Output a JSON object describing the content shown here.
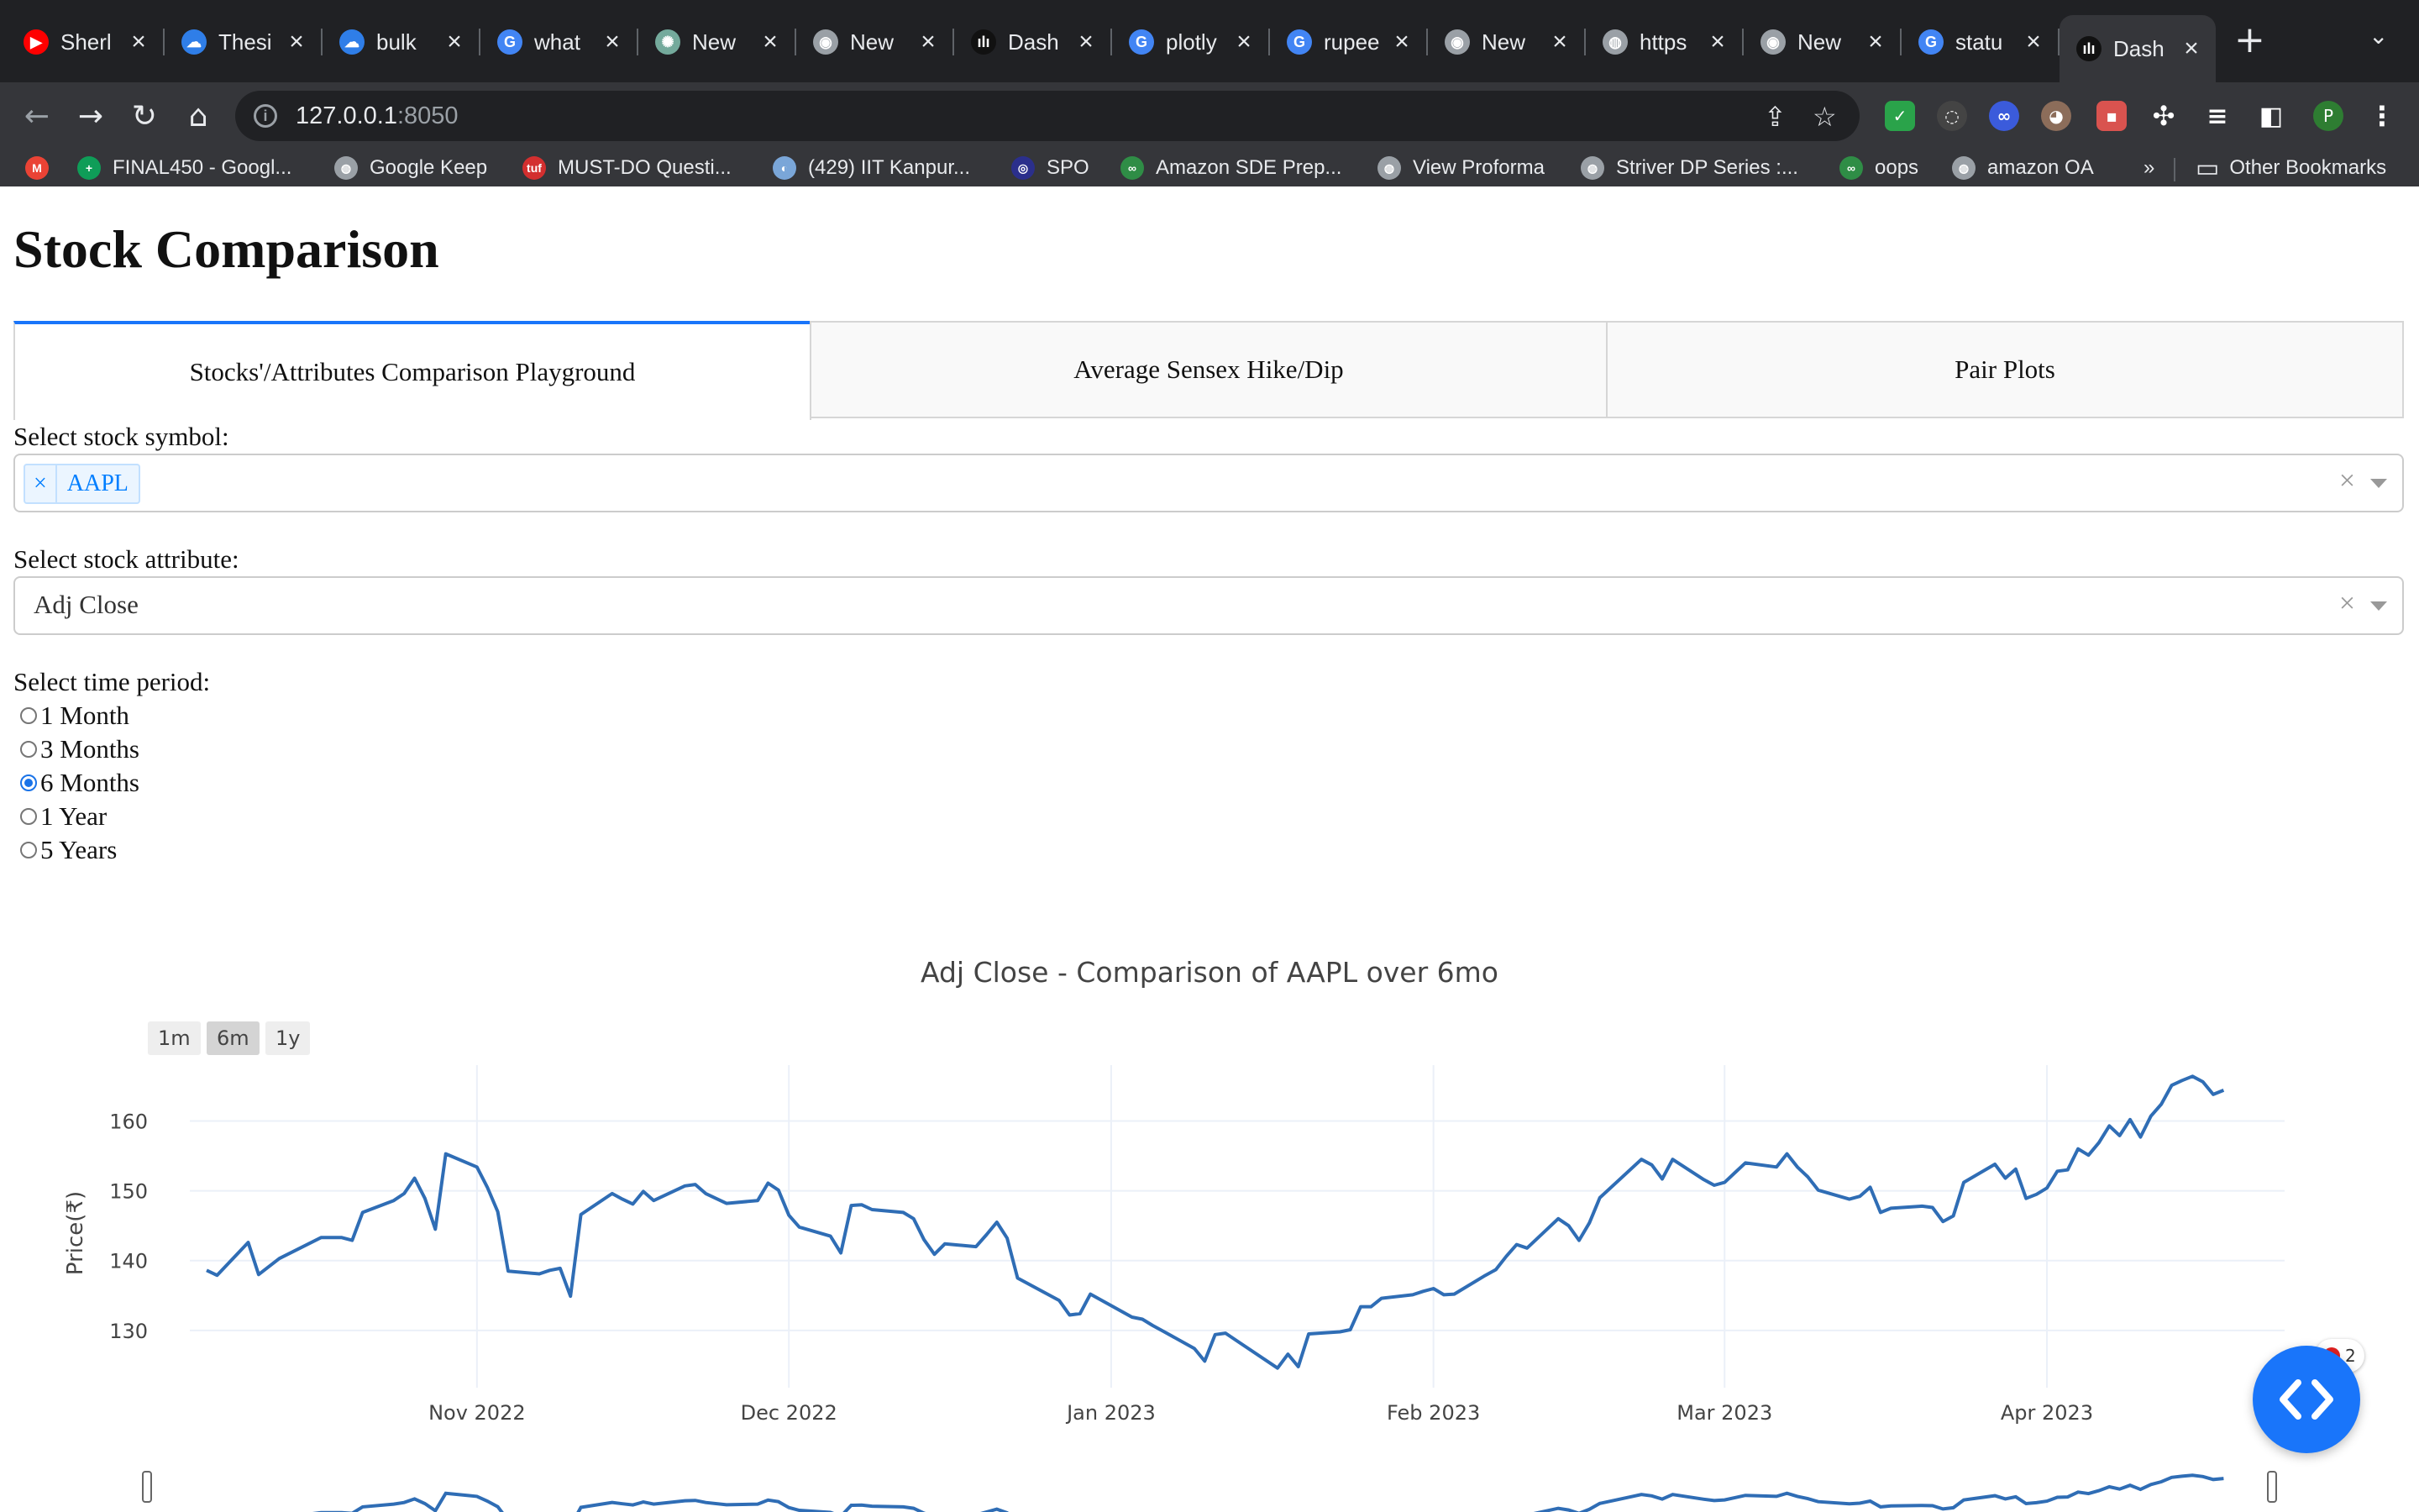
{
  "browser": {
    "tabs": [
      {
        "title": "Sherl",
        "icon": "youtube-icon",
        "color": "#ff0000"
      },
      {
        "title": "Thesi",
        "icon": "onedrive-icon",
        "color": "#2f7ee8"
      },
      {
        "title": "bulk",
        "icon": "onedrive-icon",
        "color": "#2f7ee8"
      },
      {
        "title": "what",
        "icon": "google-icon",
        "color": "#4285f4"
      },
      {
        "title": "New",
        "icon": "chatgpt-icon",
        "color": "#74aa9c"
      },
      {
        "title": "New",
        "icon": "chrome-icon",
        "color": "#9aa0a6"
      },
      {
        "title": "Dash",
        "icon": "dash-icon",
        "color": "#111111"
      },
      {
        "title": "plotly",
        "icon": "google-icon",
        "color": "#4285f4"
      },
      {
        "title": "rupee",
        "icon": "google-icon",
        "color": "#4285f4"
      },
      {
        "title": "New",
        "icon": "chrome-icon",
        "color": "#9aa0a6"
      },
      {
        "title": "https",
        "icon": "globe-icon",
        "color": "#9aa0a6"
      },
      {
        "title": "New",
        "icon": "chrome-icon",
        "color": "#9aa0a6"
      },
      {
        "title": "statu",
        "icon": "google-icon",
        "color": "#4285f4"
      },
      {
        "title": "Dash",
        "icon": "dash-icon",
        "color": "#111111"
      }
    ],
    "active_tab_index": 13,
    "address": {
      "host": "127.0.0.1",
      "port": ":8050"
    },
    "profile_initial": "P",
    "bookmarks": [
      {
        "label": "",
        "icon": "gmail-icon",
        "color": "#ea4335"
      },
      {
        "label": "FINAL450 - Googl...",
        "icon": "sheets-icon",
        "color": "#0f9d58"
      },
      {
        "label": "Google Keep",
        "icon": "globe-icon",
        "color": "#9aa0a6"
      },
      {
        "label": "MUST-DO Questi...",
        "icon": "tuf-icon",
        "color": "#d32f2f"
      },
      {
        "label": "(429) IIT Kanpur...",
        "icon": "quora-icon",
        "color": "#7aa6d8"
      },
      {
        "label": "SPO",
        "icon": "spo-icon",
        "color": "#2b2f8c"
      },
      {
        "label": "Amazon SDE Prep...",
        "icon": "gfg-icon",
        "color": "#2f8d46"
      },
      {
        "label": "View Proforma",
        "icon": "globe-icon",
        "color": "#9aa0a6"
      },
      {
        "label": "Striver DP Series :...",
        "icon": "globe-icon",
        "color": "#9aa0a6"
      },
      {
        "label": "oops",
        "icon": "gfg-icon",
        "color": "#2f8d46"
      },
      {
        "label": "amazon OA",
        "icon": "globe-icon",
        "color": "#9aa0a6"
      }
    ],
    "more_bookmarks": "»",
    "other_bookmarks": "Other Bookmarks"
  },
  "page": {
    "title": "Stock Comparison",
    "tabs": [
      {
        "label": "Stocks'/Attributes Comparison Playground"
      },
      {
        "label": "Average Sensex Hike/Dip"
      },
      {
        "label": "Pair Plots"
      }
    ],
    "selected_tab_index": 0,
    "stock_label": "Select stock symbol:",
    "stock_selected": "AAPL",
    "attribute_label": "Select stock attribute:",
    "attribute_selected": "Adj Close",
    "period_label": "Select time period:",
    "period_options": [
      "1 Month",
      "3 Months",
      "6 Months",
      "1 Year",
      "5 Years"
    ],
    "period_selected_index": 2
  },
  "chart_data": {
    "type": "line",
    "title": "Adj Close - Comparison of AAPL over 6mo",
    "ylabel": "Price(₹)",
    "xlabel": "",
    "range_buttons": [
      "1m",
      "6m",
      "1y"
    ],
    "active_range_button": "6m",
    "ylim": [
      123,
      168
    ],
    "yticks": [
      130,
      140,
      150,
      160
    ],
    "xlim": [
      "2022-10-06",
      "2023-04-05"
    ],
    "xticks": [
      {
        "date": "2022-11-01",
        "label": "Nov 2022"
      },
      {
        "date": "2022-12-01",
        "label": "Dec 2022"
      },
      {
        "date": "2023-01-01",
        "label": "Jan 2023"
      },
      {
        "date": "2023-02-01",
        "label": "Feb 2023"
      },
      {
        "date": "2023-03-01",
        "label": "Mar 2023"
      },
      {
        "date": "2023-04-01",
        "label": "Apr 2023"
      }
    ],
    "grid": true,
    "rangeslider": true,
    "line_color": "#2f6db5",
    "series": [
      {
        "name": "AAPL",
        "points": [
          [
            "2022-10-06",
            138.6
          ],
          [
            "2022-10-07",
            137.9
          ],
          [
            "2022-10-10",
            142.6
          ],
          [
            "2022-10-11",
            138.0
          ],
          [
            "2022-10-13",
            140.3
          ],
          [
            "2022-10-17",
            143.3
          ],
          [
            "2022-10-19",
            143.3
          ],
          [
            "2022-10-20",
            142.9
          ],
          [
            "2022-10-21",
            146.9
          ],
          [
            "2022-10-24",
            148.6
          ],
          [
            "2022-10-25",
            149.6
          ],
          [
            "2022-10-26",
            151.8
          ],
          [
            "2022-10-27",
            148.9
          ],
          [
            "2022-10-28",
            144.5
          ],
          [
            "2022-10-29",
            155.3
          ],
          [
            "2022-11-01",
            153.4
          ],
          [
            "2022-11-02",
            150.5
          ],
          [
            "2022-11-03",
            147.0
          ],
          [
            "2022-11-04",
            138.5
          ],
          [
            "2022-11-07",
            138.1
          ],
          [
            "2022-11-08",
            138.6
          ],
          [
            "2022-11-09",
            138.9
          ],
          [
            "2022-11-10",
            134.9
          ],
          [
            "2022-11-11",
            146.6
          ],
          [
            "2022-11-14",
            149.6
          ],
          [
            "2022-11-15",
            148.8
          ],
          [
            "2022-11-16",
            148.1
          ],
          [
            "2022-11-17",
            149.9
          ],
          [
            "2022-11-18",
            148.6
          ],
          [
            "2022-11-21",
            150.7
          ],
          [
            "2022-11-22",
            150.9
          ],
          [
            "2022-11-23",
            149.6
          ],
          [
            "2022-11-25",
            148.2
          ],
          [
            "2022-11-28",
            148.6
          ],
          [
            "2022-11-29",
            151.1
          ],
          [
            "2022-11-30",
            150.1
          ],
          [
            "2022-12-01",
            146.5
          ],
          [
            "2022-12-02",
            144.8
          ],
          [
            "2022-12-05",
            143.5
          ],
          [
            "2022-12-06",
            141.1
          ],
          [
            "2022-12-07",
            147.9
          ],
          [
            "2022-12-08",
            148.0
          ],
          [
            "2022-12-09",
            147.3
          ],
          [
            "2022-12-12",
            146.9
          ],
          [
            "2022-12-13",
            146.0
          ],
          [
            "2022-12-14",
            143.0
          ],
          [
            "2022-12-15",
            140.9
          ],
          [
            "2022-12-16",
            142.4
          ],
          [
            "2022-12-19",
            142.0
          ],
          [
            "2022-12-20",
            143.7
          ],
          [
            "2022-12-21",
            145.5
          ],
          [
            "2022-12-22",
            143.2
          ],
          [
            "2022-12-23",
            137.5
          ],
          [
            "2022-12-27",
            134.3
          ],
          [
            "2022-12-28",
            132.2
          ],
          [
            "2022-12-29",
            132.4
          ],
          [
            "2022-12-30",
            135.2
          ],
          [
            "2023-01-03",
            131.9
          ],
          [
            "2023-01-04",
            131.6
          ],
          [
            "2023-01-05",
            130.7
          ],
          [
            "2023-01-06",
            129.9
          ],
          [
            "2023-01-09",
            127.4
          ],
          [
            "2023-01-10",
            125.6
          ],
          [
            "2023-01-11",
            129.4
          ],
          [
            "2023-01-12",
            129.6
          ],
          [
            "2023-01-13",
            128.6
          ],
          [
            "2023-01-17",
            124.6
          ],
          [
            "2023-01-18",
            126.6
          ],
          [
            "2023-01-19",
            124.8
          ],
          [
            "2023-01-20",
            129.5
          ],
          [
            "2023-01-23",
            129.8
          ],
          [
            "2023-01-24",
            130.1
          ],
          [
            "2023-01-25",
            133.4
          ],
          [
            "2023-01-26",
            133.4
          ],
          [
            "2023-01-27",
            134.6
          ],
          [
            "2023-01-30",
            135.1
          ],
          [
            "2023-01-31",
            135.6
          ],
          [
            "2023-02-01",
            136.0
          ],
          [
            "2023-02-02",
            135.1
          ],
          [
            "2023-02-03",
            135.2
          ],
          [
            "2023-02-06",
            137.9
          ],
          [
            "2023-02-07",
            138.7
          ],
          [
            "2023-02-08",
            140.6
          ],
          [
            "2023-02-09",
            142.3
          ],
          [
            "2023-02-10",
            141.8
          ],
          [
            "2023-02-13",
            146.0
          ],
          [
            "2023-02-14",
            145.0
          ],
          [
            "2023-02-15",
            142.9
          ],
          [
            "2023-02-16",
            145.4
          ],
          [
            "2023-02-17",
            149.0
          ],
          [
            "2023-02-21",
            154.5
          ],
          [
            "2023-02-22",
            153.7
          ],
          [
            "2023-02-23",
            151.7
          ],
          [
            "2023-02-24",
            154.5
          ],
          [
            "2023-02-27",
            151.6
          ],
          [
            "2023-02-28",
            150.8
          ],
          [
            "2023-03-01",
            151.2
          ],
          [
            "2023-03-02",
            152.6
          ],
          [
            "2023-03-03",
            154.0
          ],
          [
            "2023-03-06",
            153.4
          ],
          [
            "2023-03-07",
            155.3
          ],
          [
            "2023-03-08",
            153.4
          ],
          [
            "2023-03-09",
            152.0
          ],
          [
            "2023-03-10",
            150.1
          ],
          [
            "2023-03-13",
            148.8
          ],
          [
            "2023-03-14",
            149.2
          ],
          [
            "2023-03-15",
            150.5
          ],
          [
            "2023-03-16",
            146.9
          ],
          [
            "2023-03-17",
            147.5
          ],
          [
            "2023-03-20",
            147.8
          ],
          [
            "2023-03-21",
            147.6
          ],
          [
            "2023-03-22",
            145.6
          ],
          [
            "2023-03-23",
            146.4
          ],
          [
            "2023-03-24",
            151.2
          ],
          [
            "2023-03-27",
            153.8
          ],
          [
            "2023-03-28",
            151.8
          ],
          [
            "2023-03-29",
            153.1
          ],
          [
            "2023-03-30",
            148.9
          ],
          [
            "2023-03-31",
            149.5
          ],
          [
            "2023-04-01",
            150.4
          ],
          [
            "2023-04-02",
            152.8
          ],
          [
            "2023-04-03",
            153.0
          ],
          [
            "2023-04-04",
            156.0
          ],
          [
            "2023-04-05",
            155.1
          ],
          [
            "2023-04-06",
            156.9
          ],
          [
            "2023-04-07",
            159.3
          ],
          [
            "2023-04-08",
            157.9
          ],
          [
            "2023-04-09",
            160.2
          ],
          [
            "2023-04-10",
            157.7
          ],
          [
            "2023-04-11",
            160.7
          ],
          [
            "2023-04-12",
            162.4
          ],
          [
            "2023-04-13",
            165.1
          ],
          [
            "2023-04-14",
            165.8
          ],
          [
            "2023-04-15",
            166.4
          ],
          [
            "2023-04-16",
            165.6
          ],
          [
            "2023-04-17",
            163.8
          ],
          [
            "2023-04-18",
            164.4
          ]
        ]
      }
    ]
  },
  "fab": {
    "badge_count": "2",
    "icon": "code-brackets-icon"
  }
}
